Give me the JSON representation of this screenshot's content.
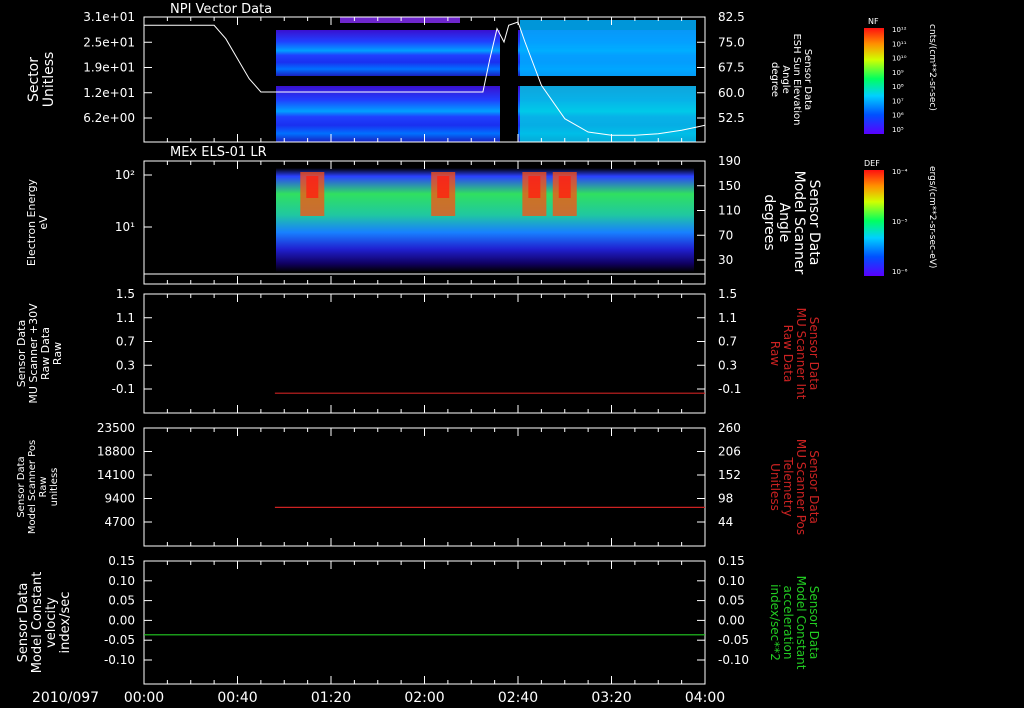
{
  "colors": {
    "background": "#000000",
    "foreground": "#ffffff",
    "red_trace": "#cc2222",
    "green_trace": "#22cc22",
    "magenta_line": "#ff00ff"
  },
  "time_axis": {
    "date_label": "2010/097",
    "ticks": [
      "00:00",
      "00:40",
      "01:20",
      "02:00",
      "02:40",
      "03:20",
      "04:00"
    ],
    "range_minutes": [
      0,
      240
    ]
  },
  "colorbars": [
    {
      "title": "NF",
      "unit_label": "cnts/(cm**2-sr-sec)",
      "tick_labels": [
        "10¹²",
        "10¹¹",
        "10¹⁰",
        "10⁹",
        "10⁸",
        "10⁷",
        "10⁶",
        "10⁵"
      ]
    },
    {
      "title": "DEF",
      "unit_label": "ergs/(cm**2-sr-sec-eV)",
      "tick_labels": [
        "10⁻⁴",
        "10⁻⁵",
        "10⁻⁶"
      ]
    }
  ],
  "chart_data": [
    {
      "type": "heatmap",
      "title": "NPI Vector Data",
      "ylabel": [
        "Sector",
        "Unitless"
      ],
      "y_ticks": [
        "3.1e+01",
        "2.5e+01",
        "1.9e+01",
        "1.2e+01",
        "6.2e+00"
      ],
      "ylim": [
        0,
        31
      ],
      "y2label": [
        "Sensor Data",
        "ESH Sun Elevation",
        "Angle",
        "degree"
      ],
      "y2_ticks": [
        "82.5",
        "75.0",
        "67.5",
        "60.0",
        "52.5"
      ],
      "y2lim": [
        45,
        82.5
      ],
      "overlay_series": {
        "name": "ESH Sun Elevation Angle",
        "x_minutes": [
          0,
          30,
          35,
          40,
          45,
          50,
          145,
          148,
          151,
          154,
          156,
          160,
          163,
          170,
          180,
          190,
          200,
          210,
          220,
          230,
          240
        ],
        "values": [
          80,
          80,
          76,
          70,
          64,
          60,
          60,
          70,
          79,
          75,
          80,
          81,
          75,
          62,
          52,
          48,
          47,
          47,
          47.5,
          48.5,
          50
        ]
      },
      "data_extent_minutes": [
        56,
        240
      ]
    },
    {
      "type": "heatmap",
      "title": "MEx ELS-01 LR",
      "ylabel": [
        "Electron Energy",
        "eV"
      ],
      "y_ticks": [
        "10²",
        "10¹"
      ],
      "y2label": [
        "Sensor Data",
        "Model Scanner",
        "Angle",
        "degrees"
      ],
      "y2_ticks": [
        "190",
        "150",
        "110",
        "70",
        "30"
      ],
      "y2lim": [
        0,
        190
      ],
      "data_extent_minutes": [
        56,
        234
      ],
      "bright_bursts_minutes": [
        72,
        128,
        167,
        180
      ]
    },
    {
      "type": "line",
      "ylabel": [
        "Sensor Data",
        "MU Scanner +30V",
        "Raw Data",
        "Raw"
      ],
      "y_ticks": [
        "1.5",
        "1.1",
        "0.7",
        "0.3",
        "-0.1"
      ],
      "ylim": [
        -0.3,
        1.5
      ],
      "y2label": [
        "Sensor Data",
        "MU Scanner Int",
        "Raw Data",
        "Raw"
      ],
      "y2_ticks": [
        "1.5",
        "1.1",
        "0.7",
        "0.3",
        "-0.1"
      ],
      "series": [
        {
          "name": "MU Scanner Int Raw Data",
          "x_minutes": [
            56,
            240
          ],
          "values": [
            0.0,
            0.0
          ]
        }
      ]
    },
    {
      "type": "line",
      "ylabel": [
        "Sensor Data",
        "Model Scanner Pos",
        "Raw",
        "unitless"
      ],
      "y_ticks": [
        "23500",
        "18800",
        "14100",
        "9400",
        "4700"
      ],
      "ylim": [
        0,
        23500
      ],
      "y2label": [
        "Sensor Data",
        "MU Scanner Pos",
        "Telemetry",
        "Unitless"
      ],
      "y2_ticks": [
        "260",
        "206",
        "152",
        "98",
        "44"
      ],
      "y2lim": [
        0,
        260
      ],
      "series": [
        {
          "name": "MU Scanner Pos Telemetry",
          "x_minutes": [
            56,
            240
          ],
          "values": [
            85,
            85
          ]
        }
      ]
    },
    {
      "type": "line",
      "ylabel": [
        "Sensor Data",
        "Model Constant",
        "velocity",
        "index/sec"
      ],
      "y_ticks": [
        "0.15",
        "0.10",
        "0.05",
        "0.00",
        "-0.05",
        "-0.10"
      ],
      "ylim": [
        -0.1,
        0.15
      ],
      "y2label": [
        "Sensor Data",
        "Model Constant",
        "acceleration",
        "index/sec**2"
      ],
      "y2_ticks": [
        "0.15",
        "0.10",
        "0.05",
        "0.00",
        "-0.05",
        "-0.10"
      ],
      "y2lim": [
        -0.1,
        0.15
      ],
      "series": [
        {
          "name": "Model Constant acceleration",
          "x_minutes": [
            0,
            240
          ],
          "values": [
            0.0,
            0.0
          ]
        }
      ]
    }
  ]
}
